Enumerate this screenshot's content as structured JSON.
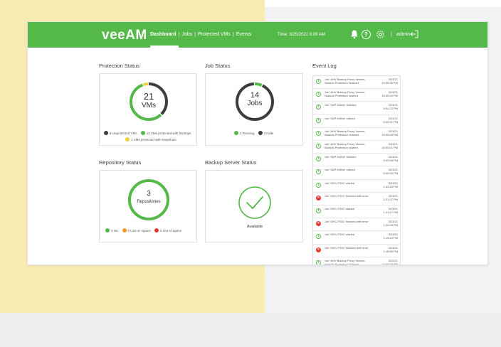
{
  "colors": {
    "brand_green": "#54b948",
    "ring_grey": "#3d3d3d",
    "ring_yellow": "#f2d335",
    "warn_orange": "#f39c2b",
    "error_red": "#e53935"
  },
  "header": {
    "logo": "veeAM",
    "nav": [
      {
        "label": "Dashboard",
        "active": true
      },
      {
        "label": "Jobs",
        "active": false
      },
      {
        "label": "Protected VMs",
        "active": false
      },
      {
        "label": "Events",
        "active": false
      }
    ],
    "time": "Time: 3/25/2021 8:09 AM",
    "icons": [
      "bell-icon",
      "help-icon",
      "gear-icon",
      "logout-icon"
    ],
    "help_glyph": "?",
    "separator": "|",
    "user": "admin"
  },
  "protection": {
    "title": "Protection Status",
    "count": "21",
    "unit": "VMs",
    "segments": {
      "unprotected": 8,
      "backups": 12,
      "snapshots": 1
    },
    "legend": [
      {
        "label": "8 Unprotected VMs",
        "color": "#3d3d3d"
      },
      {
        "label": "12 VMs protected with backups",
        "color": "#54b948"
      },
      {
        "label": "1 VMs protected with snapshots",
        "color": "#f2d335"
      }
    ]
  },
  "jobs": {
    "title": "Job Status",
    "count": "14",
    "unit": "Jobs",
    "segments": {
      "running": 1,
      "idle": 13
    },
    "legend": [
      {
        "label": "1 Running",
        "color": "#54b948"
      },
      {
        "label": "13 Idle",
        "color": "#3d3d3d"
      }
    ]
  },
  "repository": {
    "title": "Repository Status",
    "count": "3",
    "unit": "Repositories",
    "legend": [
      {
        "label": "3 OK",
        "color": "#54b948"
      },
      {
        "label": "0 Low on Space",
        "color": "#f39c2b"
      },
      {
        "label": "0 Out of Space",
        "color": "#e53935"
      }
    ]
  },
  "backup_server": {
    "title": "Backup Server Status",
    "status": "Available"
  },
  "event_log": {
    "title": "Event Log",
    "events": [
      {
        "type": "info",
        "text": "Job 'AHV Backup Proxy Veeam-Nutanix Protection' finished",
        "date": "3/24/21",
        "time": "10:00:06 PM"
      },
      {
        "type": "info",
        "text": "Job 'AHV Backup Proxy Veeam-Nutanix Protection' started",
        "date": "3/24/21",
        "time": "10:00:00 PM"
      },
      {
        "type": "info",
        "text": "Job 'SAP-HANA' finished",
        "date": "3/24/21",
        "time": "5:04:22 PM"
      },
      {
        "type": "info",
        "text": "Job 'SAP-HANA' started",
        "date": "3/24/21",
        "time": "5:00:01 PM"
      },
      {
        "type": "info",
        "text": "Job 'AHV Backup Proxy Veeam-Nutanix Protection' finished",
        "date": "3/23/21",
        "time": "10:00:05 PM"
      },
      {
        "type": "info",
        "text": "Job 'AHV Backup Proxy Veeam-Nutanix Protection' started",
        "date": "3/23/21",
        "time": "10:00:01 PM"
      },
      {
        "type": "info",
        "text": "Job 'SAP-HANA' finished",
        "date": "3/23/21",
        "time": "5:03:08 PM"
      },
      {
        "type": "info",
        "text": "Job 'SAP-HANA' started",
        "date": "3/23/21",
        "time": "5:00:00 PM"
      },
      {
        "type": "info",
        "text": "Job 'GHC-FS01' started",
        "date": "3/23/21",
        "time": "1:42:18 PM"
      },
      {
        "type": "error",
        "text": "Job 'GHC-FS01' finished with error",
        "date": "3/23/21",
        "time": "1:21:07 PM"
      },
      {
        "type": "info",
        "text": "Job 'GHC-FS01' started",
        "date": "3/23/21",
        "time": "1:21:17 PM"
      },
      {
        "type": "error",
        "text": "Job 'GHC-FS01' finished with error",
        "date": "3/23/21",
        "time": "1:20:09 PM"
      },
      {
        "type": "info",
        "text": "Job 'GHC-FS01' started",
        "date": "3/23/21",
        "time": "1:19:42 PM"
      },
      {
        "type": "error",
        "text": "Job 'GHC-FS01' finished with error",
        "date": "3/23/21",
        "time": "1:18:50 PM"
      },
      {
        "type": "info",
        "text": "Job 'AHV Backup Proxy Veeam-Nutanix Protection' finished",
        "date": "3/22/21",
        "time": "10:00:05 PM"
      },
      {
        "type": "info",
        "text": "Job 'AHV Backup Proxy Veeam-Nutanix Protection' started",
        "date": "3/22/21",
        "time": "10:00:01 PM"
      }
    ]
  }
}
